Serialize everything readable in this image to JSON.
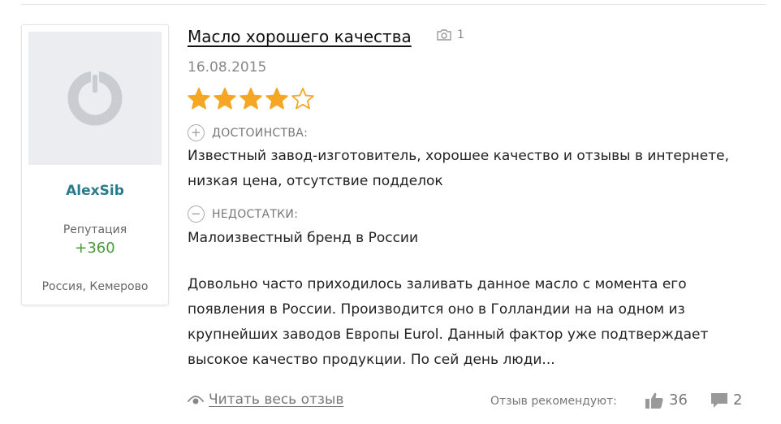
{
  "author": {
    "name": "AlexSib",
    "reputation_label": "Репутация",
    "reputation_value": "+360",
    "location": "Россия, Кемерово",
    "avatar_icon": "default-avatar-icon"
  },
  "review": {
    "title": "Масло хорошего качества",
    "photo_count": "1",
    "photo_icon": "camera-icon",
    "date": "16.08.2015",
    "rating": 4,
    "rating_max": 5,
    "pros_label": "ДОСТОИНСТВА:",
    "pros_text": "Известный завод-изготовитель, хорошее качество и отзывы в интернете, низкая цена, отсутствие подделок",
    "cons_label": "НЕДОСТАТКИ:",
    "cons_text": "Малоизвестный бренд в России",
    "body": "Довольно часто приходилось заливать данное масло с момента его появления в России. Производится оно в Голландии на на одном из крупнейших заводов Европы Eurol. Данный фактор уже подтверждает высокое качество продукции. По сей день люди..."
  },
  "footer": {
    "read_more": "Читать весь отзыв",
    "recommend_label": "Отзыв рекомендуют:",
    "likes": "36",
    "comments": "2"
  },
  "colors": {
    "star_fill": "#f5a623",
    "author_name": "#2a7a8c",
    "reputation": "#4a9a3a",
    "muted": "#888888"
  }
}
